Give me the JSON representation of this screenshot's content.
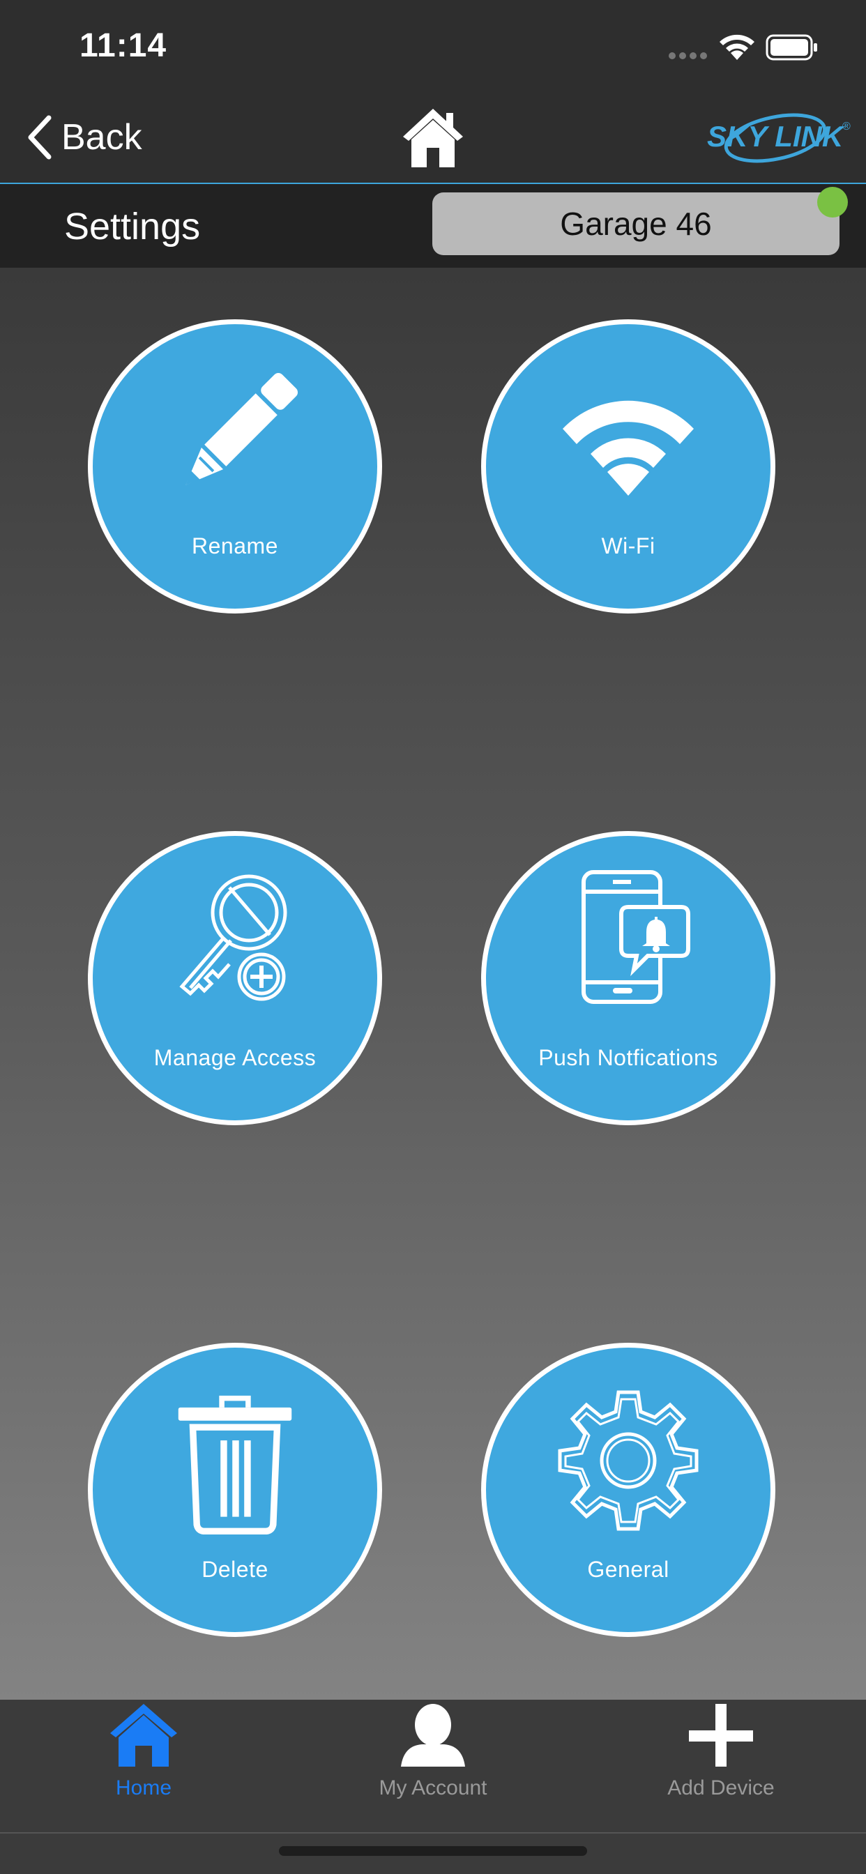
{
  "status_bar": {
    "time": "11:14"
  },
  "nav": {
    "back_label": "Back",
    "brand": "SKY LINK",
    "brand_mark": "®"
  },
  "header": {
    "title": "Settings",
    "device_name": "Garage 46",
    "status_color": "#7ac143"
  },
  "tiles": [
    {
      "label": "Rename",
      "icon": "pencil-icon"
    },
    {
      "label": "Wi-Fi",
      "icon": "wifi-icon"
    },
    {
      "label": "Manage Access",
      "icon": "key-plus-icon"
    },
    {
      "label": "Push Notfications",
      "icon": "phone-bell-icon"
    },
    {
      "label": "Delete",
      "icon": "trash-icon"
    },
    {
      "label": "General",
      "icon": "gear-icon"
    }
  ],
  "tab_bar": {
    "items": [
      {
        "label": "Home",
        "icon": "home-icon",
        "active": true
      },
      {
        "label": "My Account",
        "icon": "user-icon",
        "active": false
      },
      {
        "label": "Add Device",
        "icon": "plus-icon",
        "active": false
      }
    ]
  },
  "colors": {
    "accent": "#3fa8df",
    "active_tab": "#1a7cf5"
  }
}
